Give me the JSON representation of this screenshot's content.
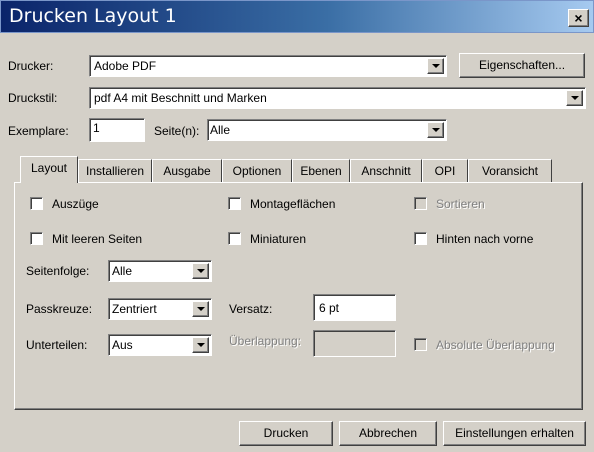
{
  "window": {
    "title": "Drucken Layout 1",
    "close_label": "×"
  },
  "printer": {
    "label": "Drucker:",
    "value": "Adobe PDF",
    "properties_button": "Eigenschaften..."
  },
  "style": {
    "label": "Druckstil:",
    "value": "pdf A4 mit Beschnitt und Marken"
  },
  "copies": {
    "label": "Exemplare:",
    "value": "1"
  },
  "pages": {
    "label": "Seite(n):",
    "value": "Alle"
  },
  "tabs": [
    {
      "label": "Layout",
      "active": true
    },
    {
      "label": "Installieren"
    },
    {
      "label": "Ausgabe"
    },
    {
      "label": "Optionen"
    },
    {
      "label": "Ebenen"
    },
    {
      "label": "Anschnitt"
    },
    {
      "label": "OPI"
    },
    {
      "label": "Voransicht"
    }
  ],
  "layout": {
    "checkboxes": {
      "separations": {
        "label": "Auszüge",
        "checked": false,
        "enabled": true
      },
      "spreads": {
        "label": "Montageflächen",
        "checked": false,
        "enabled": true
      },
      "collate": {
        "label": "Sortieren",
        "checked": false,
        "enabled": false
      },
      "blank_pages": {
        "label": "Mit leeren Seiten",
        "checked": false,
        "enabled": true
      },
      "thumbnails": {
        "label": "Miniaturen",
        "checked": false,
        "enabled": true
      },
      "back_to_front": {
        "label": "Hinten nach vorne",
        "checked": false,
        "enabled": true
      },
      "absolute_overlap": {
        "label": "Absolute Überlappung",
        "checked": false,
        "enabled": false
      }
    },
    "page_sequence": {
      "label": "Seitenfolge:",
      "value": "Alle"
    },
    "registration": {
      "label": "Passkreuze:",
      "value": "Zentriert"
    },
    "offset": {
      "label": "Versatz:",
      "value": "6 pt"
    },
    "tiling": {
      "label": "Unterteilen:",
      "value": "Aus"
    },
    "overlap": {
      "label": "Überlappung:",
      "value": ""
    }
  },
  "footer": {
    "print_button": "Drucken",
    "cancel_button": "Abbrechen",
    "save_settings_button": "Einstellungen erhalten"
  }
}
